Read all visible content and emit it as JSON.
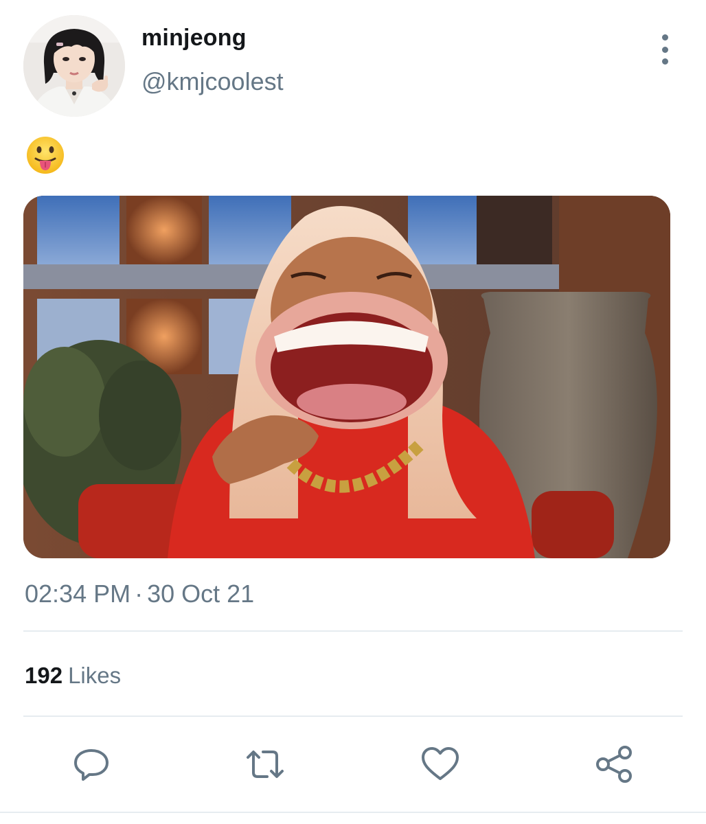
{
  "tweet": {
    "author": {
      "display_name": "minjeong",
      "handle": "@kmjcoolest",
      "avatar": "profile-photo"
    },
    "text": "😛",
    "text_icon": "tongue-out-emoji",
    "media": {
      "type": "photo",
      "subject": "laughing-woman-meme"
    },
    "time": "02:34 PM",
    "separator": "·",
    "date": "30 Oct 21",
    "likes": {
      "count": "192",
      "label": "Likes"
    }
  },
  "actions": [
    {
      "name": "reply",
      "icon": "comment-icon"
    },
    {
      "name": "retweet",
      "icon": "retweet-icon"
    },
    {
      "name": "like",
      "icon": "heart-icon"
    },
    {
      "name": "share",
      "icon": "share-icon"
    }
  ],
  "colors": {
    "primary_text": "#14171a",
    "secondary_text": "#657786",
    "divider": "#e6ecf0",
    "icon": "#657786"
  }
}
